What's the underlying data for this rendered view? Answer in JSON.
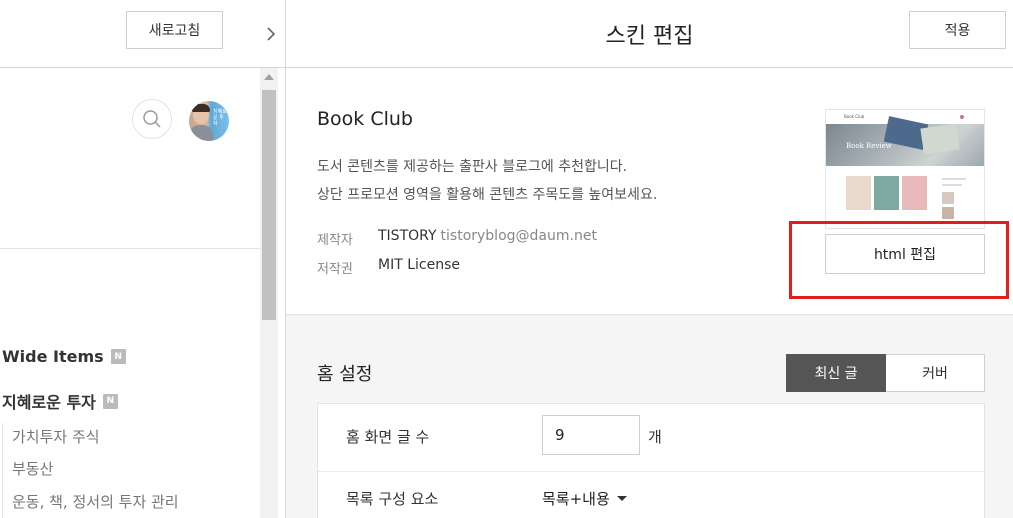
{
  "preview": {
    "refresh_label": "새로고침",
    "avatar_text": "지혜로운 투자",
    "categories": [
      {
        "title": "Wide Items",
        "badge": "N"
      },
      {
        "title": "지혜로운 투자",
        "badge": "N"
      }
    ],
    "sub_items": [
      "가치투자 주식",
      "부동산",
      "운동, 책, 정서의 투자 관리"
    ]
  },
  "header": {
    "title": "스킨 편집",
    "apply_label": "적용"
  },
  "skin": {
    "name": "Book Club",
    "description": [
      "도서 콘텐츠를 제공하는 출판사 블로그에 추천합니다.",
      "상단 프로모션 영역을 활용해 콘텐츠 주목도를 높여보세요."
    ],
    "maker_label": "제작자",
    "maker_value": "TISTORY",
    "maker_email": "tistoryblog@daum.net",
    "license_label": "저작권",
    "license_value": "MIT License",
    "thumbnail": {
      "brand": "Book Club",
      "hero_title": "Book Review"
    },
    "html_edit_label": "html 편집"
  },
  "home": {
    "title": "홈 설정",
    "tabs": [
      {
        "label": "최신 글",
        "active": true
      },
      {
        "label": "커버",
        "active": false
      }
    ],
    "post_count_label": "홈 화면 글 수",
    "post_count_value": "9",
    "post_count_unit": "개",
    "list_element_label": "목록 구성 요소",
    "list_element_value": "목록+내용"
  },
  "colors": {
    "highlight": "#e01e1e",
    "active_tab": "#555555"
  }
}
